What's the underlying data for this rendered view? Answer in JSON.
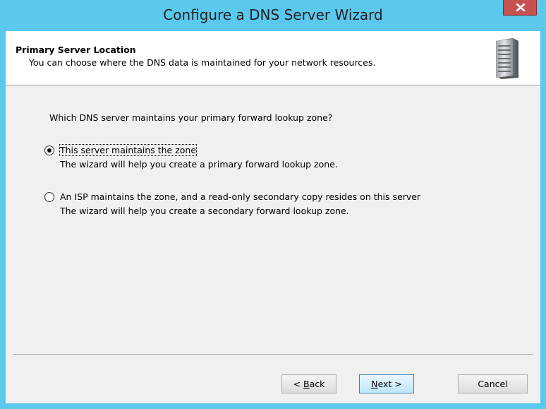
{
  "window": {
    "title": "Configure a DNS Server Wizard",
    "close_icon": "close-icon"
  },
  "header": {
    "title": "Primary Server Location",
    "subtitle": "You can choose where the DNS data is maintained for your network resources.",
    "icon": "server-icon"
  },
  "content": {
    "question": "Which DNS server maintains your primary forward lookup zone?",
    "options": [
      {
        "label": "This server maintains the zone",
        "description": "The wizard will help you create a primary forward lookup zone.",
        "selected": true
      },
      {
        "label": "An ISP maintains the zone, and a read-only secondary copy resides on this server",
        "description": "The wizard will help you create a secondary forward lookup zone.",
        "selected": false
      }
    ]
  },
  "buttons": {
    "back_prefix": "< ",
    "back_key": "B",
    "back_rest": "ack",
    "next_key": "N",
    "next_rest": "ext >",
    "cancel": "Cancel"
  },
  "colors": {
    "title_bar": "#5bc8ee",
    "close_button": "#c75050",
    "dialog_bg": "#f0f0f0"
  }
}
